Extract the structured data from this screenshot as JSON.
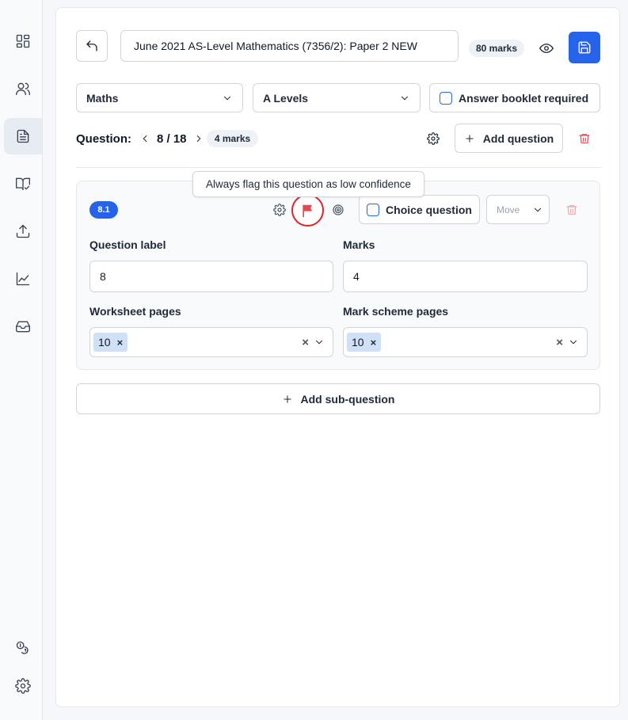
{
  "sidebar": {
    "items": [
      {
        "name": "dashboard",
        "icon": "grid-icon",
        "active": false
      },
      {
        "name": "users",
        "icon": "users-icon",
        "active": false
      },
      {
        "name": "papers",
        "icon": "document-icon",
        "active": true
      },
      {
        "name": "mark-schemes",
        "icon": "book-check-icon",
        "active": false
      },
      {
        "name": "upload",
        "icon": "upload-icon",
        "active": false
      },
      {
        "name": "analytics",
        "icon": "chart-icon",
        "active": false
      },
      {
        "name": "inbox",
        "icon": "inbox-icon",
        "active": false
      }
    ],
    "bottom": [
      {
        "name": "credits",
        "icon": "coins-icon"
      },
      {
        "name": "settings",
        "icon": "gear-icon"
      }
    ]
  },
  "header": {
    "paper_title": "June 2021 AS-Level Mathematics (7356/2): Paper 2 NEW",
    "total_marks": "80 marks"
  },
  "filters": {
    "subject": "Maths",
    "level": "A Levels",
    "answer_booklet_label": "Answer booklet required"
  },
  "question_nav": {
    "label": "Question:",
    "position": "8 / 18",
    "marks": "4 marks",
    "add_question_label": "Add question"
  },
  "tooltip": {
    "text": "Always flag this question as low confidence"
  },
  "subquestion": {
    "badge": "8.1",
    "choice_label": "Choice question",
    "move_label": "Move",
    "question_label_title": "Question label",
    "question_label_value": "8",
    "marks_title": "Marks",
    "marks_value": "4",
    "worksheet_pages_title": "Worksheet pages",
    "worksheet_pages": [
      "10"
    ],
    "mark_scheme_pages_title": "Mark scheme pages",
    "mark_scheme_pages": [
      "10"
    ]
  },
  "add_subquestion_label": "Add sub-question",
  "colors": {
    "primary": "#2563eb",
    "danger": "#e5484d",
    "chip": "#cfe0f7"
  }
}
